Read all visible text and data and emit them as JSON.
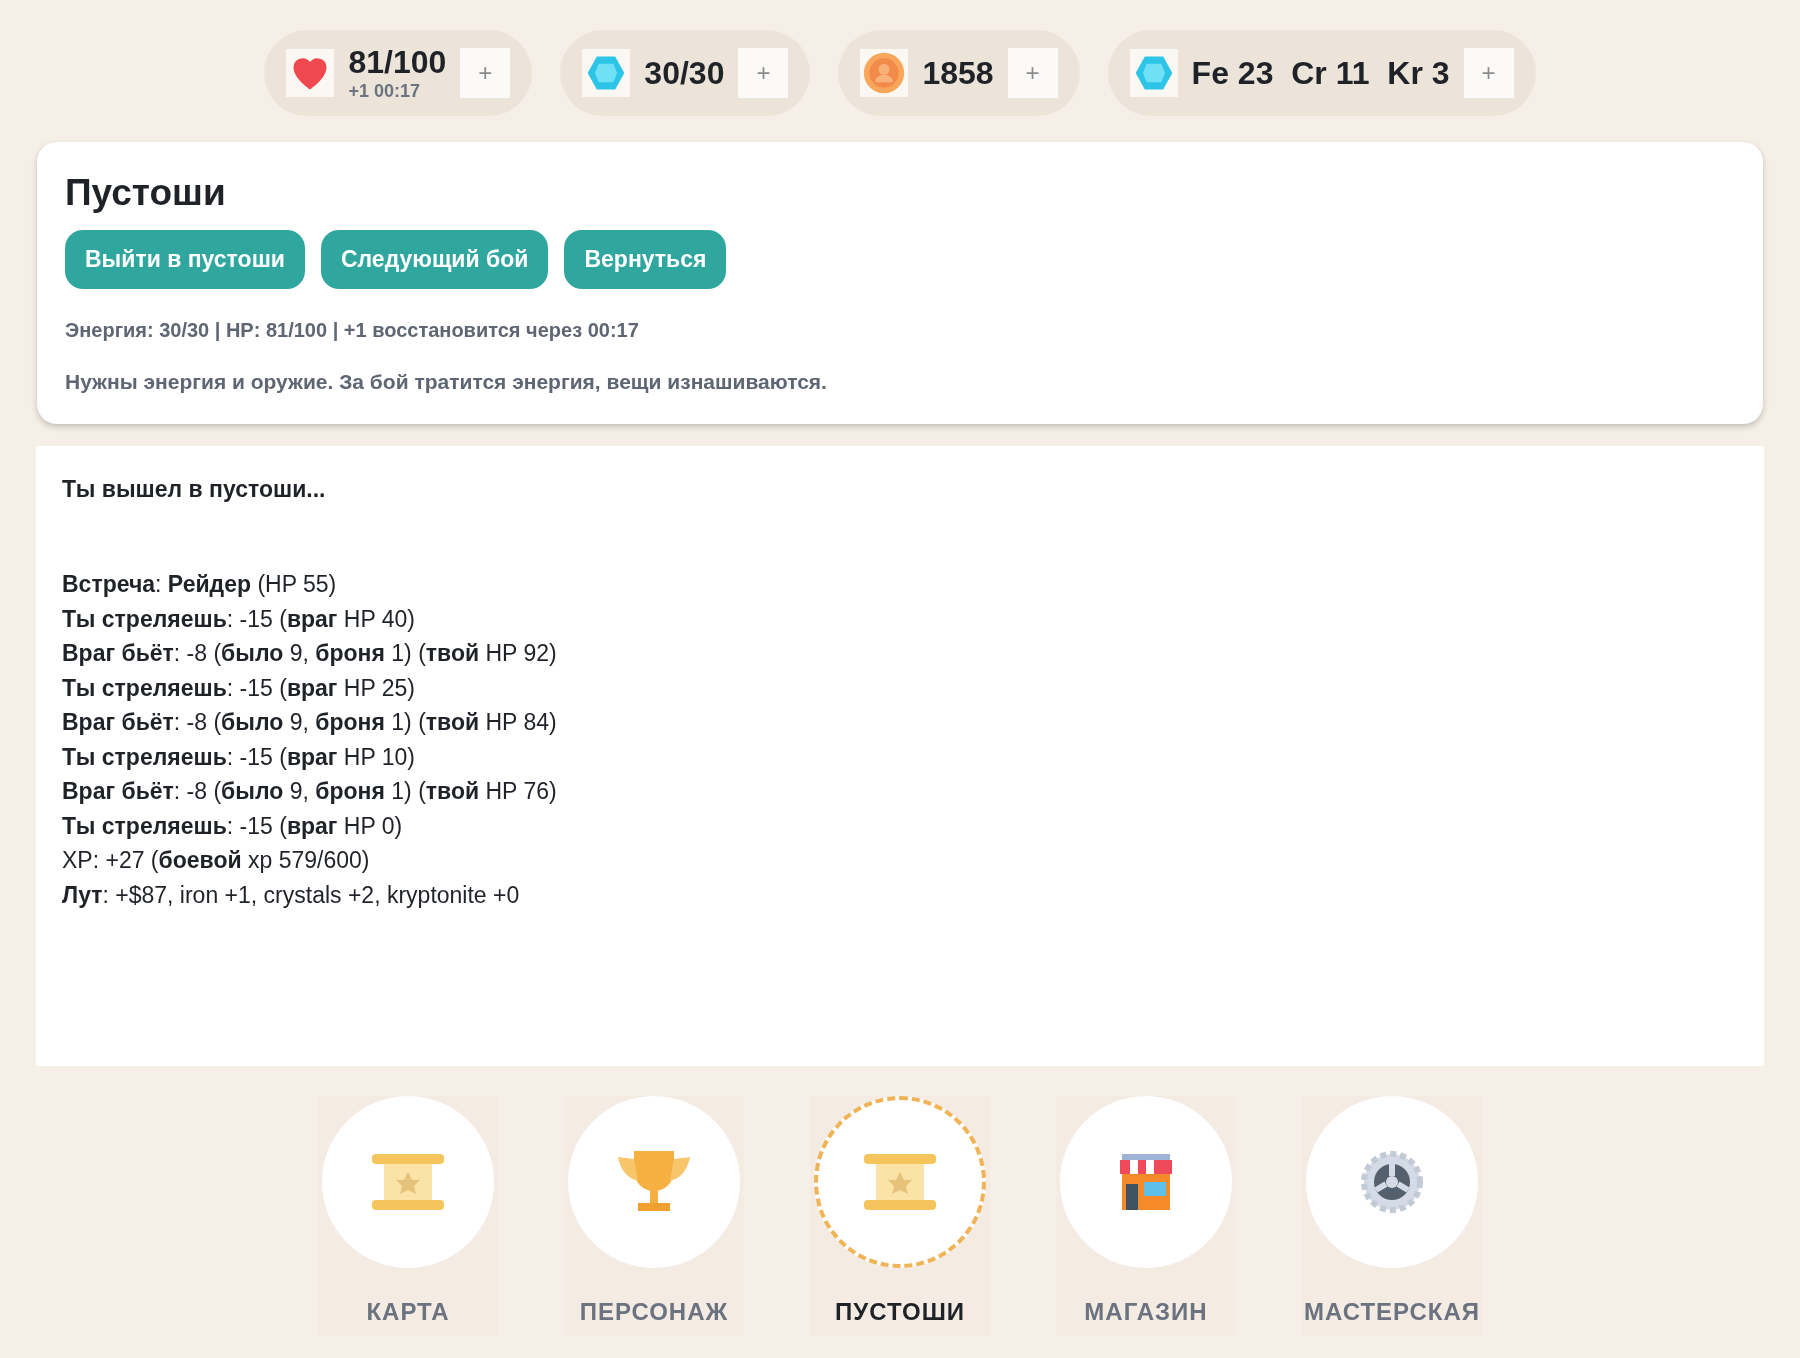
{
  "resources": [
    {
      "kind": "heart",
      "value": "81/100",
      "sub": "+1 00:17",
      "button": "+"
    },
    {
      "kind": "crystal",
      "value": "30/30",
      "button": "+"
    },
    {
      "kind": "coin",
      "value": "1858",
      "button": "+"
    },
    {
      "kind": "crystal",
      "value": "Fe 23  Cr 11  Kr 3",
      "button": "+"
    }
  ],
  "panel": {
    "title": "Пустоши",
    "buttons": [
      "Выйти в пустоши",
      "Следующий бой",
      "Вернуться"
    ],
    "status": "Энергия: 30/30 | HP: 81/100 | +1 восстановится через 00:17",
    "hint": "Нужны энергия и оружие. За бой тратится энергия, вещи изнашиваются."
  },
  "log": {
    "intro": "Ты вышел в пустоши...",
    "lines": [
      "**Встреча**: **Рейдер** (HP 55)",
      "**Ты стреляешь**: -15 (**враг** HP 40)",
      "**Враг бьёт**: -8 (**было** 9, **броня** 1) (**твой** HP 92)",
      "**Ты стреляешь**: -15 (**враг** HP 25)",
      "**Враг бьёт**: -8 (**было** 9, **броня** 1) (**твой** HP 84)",
      "**Ты стреляешь**: -15 (**враг** HP 10)",
      "**Враг бьёт**: -8 (**было** 9, **броня** 1) (**твой** HP 76)",
      "**Ты стреляешь**: -15 (**враг** HP 0)",
      "XP: +27 (**боевой** xp 579/600)",
      "**Лут**: +$87, iron +1, crystals +2, kryptonite +0"
    ]
  },
  "nav": [
    {
      "kind": "scroll",
      "label": "КАРТА",
      "selected": false
    },
    {
      "kind": "trophy",
      "label": "ПЕРСОНАЖ",
      "selected": false
    },
    {
      "kind": "scroll",
      "label": "ПУСТОШИ",
      "selected": true
    },
    {
      "kind": "shop",
      "label": "МАГАЗИН",
      "selected": false
    },
    {
      "kind": "gear",
      "label": "МАСТЕРСКАЯ",
      "selected": false
    }
  ]
}
